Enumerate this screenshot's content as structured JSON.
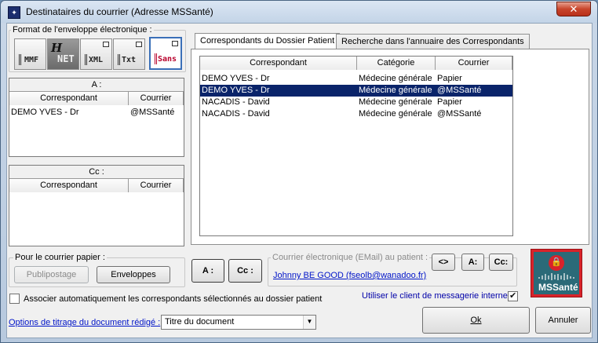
{
  "window": {
    "title": "Destinataires du courrier (Adresse MSSanté)",
    "close_glyph": "✕"
  },
  "format_group": {
    "legend": "Format de l'enveloppe électronique :",
    "buttons": [
      {
        "label": "MMF"
      },
      {
        "label": "NET"
      },
      {
        "label": "XML"
      },
      {
        "label": "Txt"
      },
      {
        "label": "Sans"
      }
    ]
  },
  "a_panel": {
    "title": "A :",
    "col_correspondant": "Correspondant",
    "col_courrier": "Courrier",
    "rows": [
      {
        "correspondant": "DEMO YVES - Dr",
        "courrier": "@MSSanté"
      }
    ]
  },
  "cc_panel": {
    "title": "Cc :",
    "col_correspondant": "Correspondant",
    "col_courrier": "Courrier"
  },
  "tabs": [
    {
      "label": "Correspondants du Dossier Patient"
    },
    {
      "label": "Recherche dans l'annuaire des Correspondants"
    }
  ],
  "main_list": {
    "columns": [
      "Correspondant",
      "Catégorie",
      "Courrier"
    ],
    "rows": [
      {
        "correspondant": "DEMO YVES - Dr",
        "categorie": "Médecine générale",
        "courrier": "Papier"
      },
      {
        "correspondant": "DEMO YVES - Dr",
        "categorie": "Médecine générale",
        "courrier": "@MSSanté"
      },
      {
        "correspondant": "NACADIS - David",
        "categorie": "Médecine générale",
        "courrier": "Papier"
      },
      {
        "correspondant": "NACADIS - David",
        "categorie": "Médecine générale",
        "courrier": "@MSSanté"
      }
    ]
  },
  "paper_group": {
    "legend": "Pour le courrier papier :",
    "publipostage": "Publipostage",
    "enveloppes": "Enveloppes"
  },
  "a_button": "A :",
  "cc_button": "Cc :",
  "email_group": {
    "legend": "Courrier électronique (EMail) au patient :",
    "link": "Johnny BE GOOD (fseolb@wanadoo.fr)",
    "swap": "<>",
    "a": "A:",
    "cc": "Cc:"
  },
  "logo": {
    "text": "MSSanté"
  },
  "auto_assoc": {
    "label": "Associer automatiquement les correspondants sélectionnés au dossier patient"
  },
  "messagerie": {
    "label": "Utiliser le client de messagerie interne"
  },
  "options": {
    "link": "Options de titrage du document rédigé :",
    "value": "Titre du document"
  },
  "ok_button": "Ok",
  "annuler_button": "Annuler"
}
